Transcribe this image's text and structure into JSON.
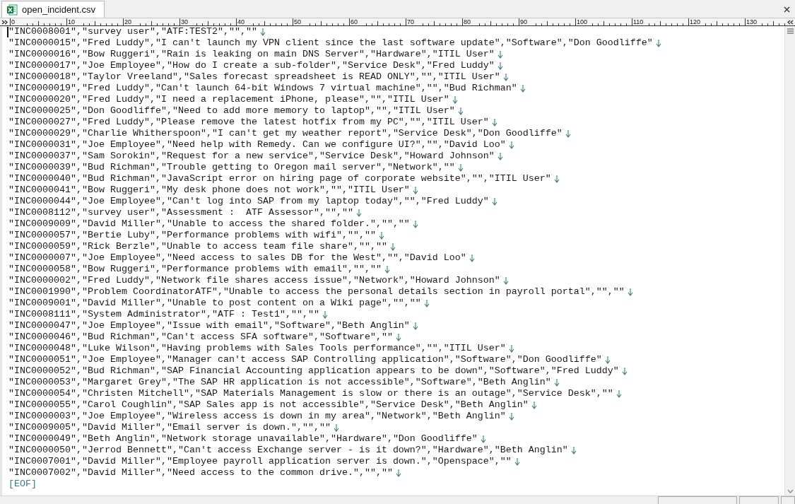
{
  "tab": {
    "title": "open_incident.csv",
    "selected": true
  },
  "ruler": {
    "labels": [
      "0",
      "10",
      "20",
      "30",
      "40",
      "50",
      "60",
      "70",
      "80",
      "90",
      "100",
      "110",
      "120",
      "130"
    ]
  },
  "lines": [
    {
      "text": "\"INC0008001\",\"survey user\",\"ATF:TEST2\",\"\",\"\"",
      "caret": true
    },
    {
      "text": "\"INC0000015\",\"Fred Luddy\",\"I can't launch my VPN client since the last software update\",\"Software\",\"Don Goodliffe\"",
      "caret": false
    },
    {
      "text": "\"INC0000016\",\"Bow Ruggeri\",\"Rain is leaking on main DNS Server\",\"Hardware\",\"ITIL User\"",
      "caret": false
    },
    {
      "text": "\"INC0000017\",\"Joe Employee\",\"How do I create a sub-folder\",\"Service Desk\",\"Fred Luddy\"",
      "caret": false
    },
    {
      "text": "\"INC0000018\",\"Taylor Vreeland\",\"Sales forecast spreadsheet is READ ONLY\",\"\",\"ITIL User\"",
      "caret": false
    },
    {
      "text": "\"INC0000019\",\"Fred Luddy\",\"Can't launch 64-bit Windows 7 virtual machine\",\"\",\"Bud Richman\"",
      "caret": false
    },
    {
      "text": "\"INC0000020\",\"Fred Luddy\",\"I need a replacement iPhone, please\",\"\",\"ITIL User\"",
      "caret": false
    },
    {
      "text": "\"INC0000025\",\"Don Goodliffe\",\"Need to add more memory to laptop\",\"\",\"ITIL User\"",
      "caret": false
    },
    {
      "text": "\"INC0000027\",\"Fred Luddy\",\"Please remove the latest hotfix from my PC\",\"\",\"ITIL User\"",
      "caret": false
    },
    {
      "text": "\"INC0000029\",\"Charlie Whitherspoon\",\"I can't get my weather report\",\"Service Desk\",\"Don Goodliffe\"",
      "caret": false
    },
    {
      "text": "\"INC0000031\",\"Joe Employee\",\"Need help with Remedy. Can we configure UI?\",\"\",\"David Loo\"",
      "caret": false
    },
    {
      "text": "\"INC0000037\",\"Sam Sorokin\",\"Request for a new service\",\"Service Desk\",\"Howard Johnson\"",
      "caret": false
    },
    {
      "text": "\"INC0000039\",\"Bud Richman\",\"Trouble getting to Oregon mail server\",\"Network\",\"\"",
      "caret": false
    },
    {
      "text": "\"INC0000040\",\"Bud Richman\",\"JavaScript error on hiring page of corporate website\",\"\",\"ITIL User\"",
      "caret": false
    },
    {
      "text": "\"INC0000041\",\"Bow Ruggeri\",\"My desk phone does not work\",\"\",\"ITIL User\"",
      "caret": false
    },
    {
      "text": "\"INC0000044\",\"Joe Employee\",\"Can't log into SAP from my laptop today\",\"\",\"Fred Luddy\"",
      "caret": false
    },
    {
      "text": "\"INC0008112\",\"survey user\",\"Assessment :  ATF Assessor\",\"\",\"\"",
      "caret": false
    },
    {
      "text": "\"INC0009009\",\"David Miller\",\"Unable to access the shared folder.\",\"\",\"\"",
      "caret": false
    },
    {
      "text": "\"INC0000057\",\"Bertie Luby\",\"Performance problems with wifi\",\"\",\"\"",
      "caret": false
    },
    {
      "text": "\"INC0000059\",\"Rick Berzle\",\"Unable to access team file share\",\"\",\"\"",
      "caret": false
    },
    {
      "text": "\"INC0000007\",\"Joe Employee\",\"Need access to sales DB for the West\",\"\",\"David Loo\"",
      "caret": false
    },
    {
      "text": "\"INC0000058\",\"Bow Ruggeri\",\"Performance problems with email\",\"\",\"\"",
      "caret": false
    },
    {
      "text": "\"INC0000002\",\"Fred Luddy\",\"Network file shares access issue\",\"Network\",\"Howard Johnson\"",
      "caret": false
    },
    {
      "text": "\"INC0001990\",\"Problem CoordinatorATF\",\"Unable to access the personal details section in payroll portal\",\"\",\"\"",
      "caret": false
    },
    {
      "text": "\"INC0009001\",\"David Miller\",\"Unable to post content on a Wiki page\",\"\",\"\"",
      "caret": false
    },
    {
      "text": "\"INC0008111\",\"System Administrator\",\"ATF : Test1\",\"\",\"\"",
      "caret": false
    },
    {
      "text": "\"INC0000047\",\"Joe Employee\",\"Issue with email\",\"Software\",\"Beth Anglin\"",
      "caret": false
    },
    {
      "text": "\"INC0000046\",\"Bud Richman\",\"Can't access SFA software\",\"Software\",\"\"",
      "caret": false
    },
    {
      "text": "\"INC0000048\",\"Luke Wilson\",\"Having problems with Sales Tools performance\",\"\",\"ITIL User\"",
      "caret": false
    },
    {
      "text": "\"INC0000051\",\"Joe Employee\",\"Manager can't access SAP Controlling application\",\"Software\",\"Don Goodliffe\"",
      "caret": false
    },
    {
      "text": "\"INC0000052\",\"Bud Richman\",\"SAP Financial Accounting application appears to be down\",\"Software\",\"Fred Luddy\"",
      "caret": false
    },
    {
      "text": "\"INC0000053\",\"Margaret Grey\",\"The SAP HR application is not accessible\",\"Software\",\"Beth Anglin\"",
      "caret": false
    },
    {
      "text": "\"INC0000054\",\"Christen Mitchell\",\"SAP Materials Management is slow or there is an outage\",\"Service Desk\",\"\"",
      "caret": false
    },
    {
      "text": "\"INC0000055\",\"Carol Coughlin\",\"SAP Sales app is not accessible\",\"Service Desk\",\"Beth Anglin\"",
      "caret": false
    },
    {
      "text": "\"INC0000003\",\"Joe Employee\",\"Wireless access is down in my area\",\"Network\",\"Beth Anglin\"",
      "caret": false
    },
    {
      "text": "\"INC0009005\",\"David Miller\",\"Email server is down.\",\"\",\"\"",
      "caret": false
    },
    {
      "text": "\"INC0000049\",\"Beth Anglin\",\"Network storage unavailable\",\"Hardware\",\"Don Goodliffe\"",
      "caret": false
    },
    {
      "text": "\"INC0000050\",\"Jerrod Bennett\",\"Can't access Exchange server - is it down?\",\"Hardware\",\"Beth Anglin\"",
      "caret": false
    },
    {
      "text": "\"INC0007001\",\"David Miller\",\"Employee payroll application server is down.\",\"Openspace\",\"\"",
      "caret": false
    },
    {
      "text": "\"INC0007002\",\"David Miller\",\"Need access to the common drive.\",\"\",\"\"",
      "caret": false
    }
  ],
  "eof_marker": "[EOF]"
}
